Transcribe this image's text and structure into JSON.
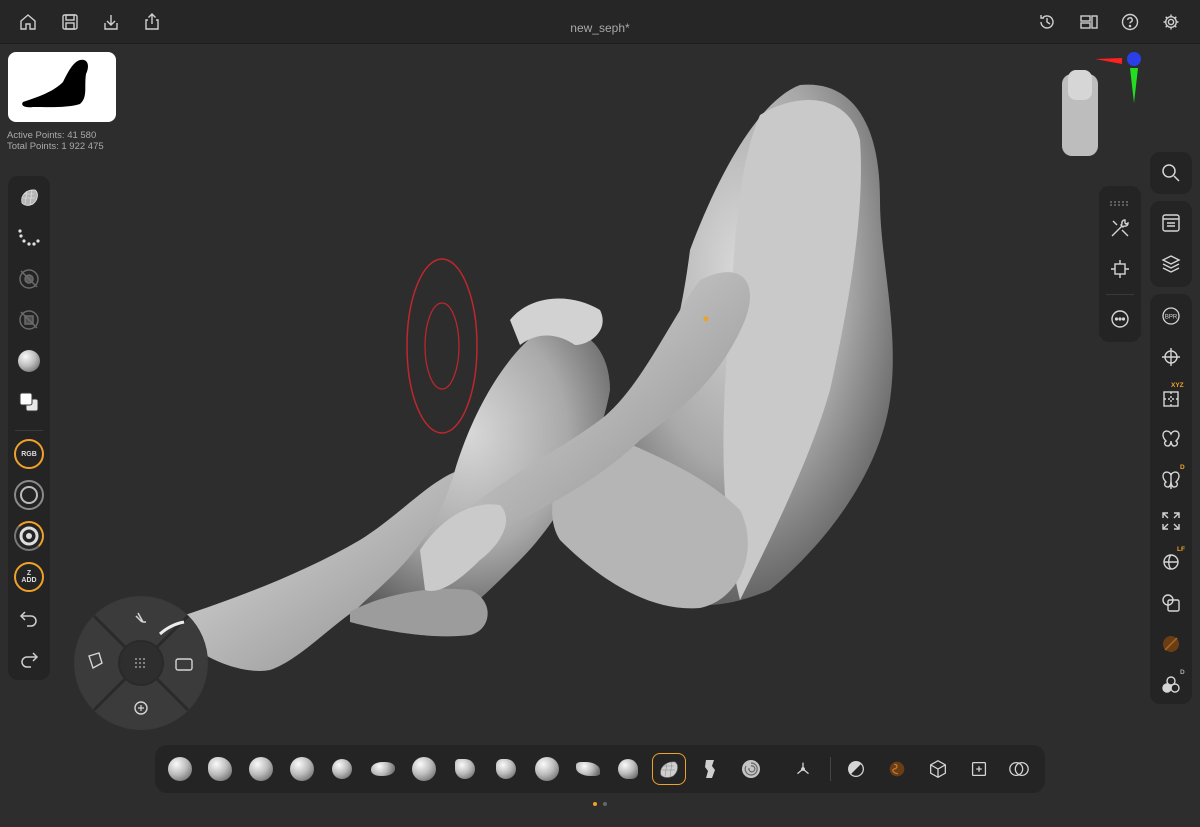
{
  "document": {
    "title": "new_seph*"
  },
  "stats": {
    "active_points": "Active Points: 41 580",
    "total_points": "Total Points: 1 922 475"
  },
  "top_toolbar": {
    "left_icons": [
      "home-icon",
      "save-icon",
      "import-icon",
      "share-icon"
    ],
    "right_icons": [
      "history-icon",
      "layout-icon",
      "help-icon",
      "settings-icon"
    ]
  },
  "left_toolbar": {
    "tools": [
      "mesh-icon",
      "stroke-icon",
      "alpha-off-icon",
      "texture-off-icon",
      "material-icon",
      "color-swatch-icon"
    ],
    "dials": {
      "rgb": {
        "top": "RGB",
        "sub": ""
      },
      "focal": {
        "top": ""
      },
      "intensity": {
        "top": ""
      },
      "zadd": {
        "top": "Z",
        "sub": "ADD"
      }
    },
    "history": [
      "undo-icon",
      "redo-icon"
    ]
  },
  "right_top_panel": {
    "tools": [
      "tools-icon",
      "gizmo-icon",
      "more-icon"
    ]
  },
  "right_toolbar": {
    "tools": [
      "search-icon",
      "palette-icon",
      "layers-icon",
      "bpr-icon",
      "transform-icon",
      "symmetry-xyz-icon",
      "symmetry-icon",
      "symmetry-d-icon",
      "frame-icon",
      "lightbox-icon",
      "duplicate-icon",
      "polyframe-icon",
      "solo-icon"
    ],
    "labels": {
      "xyz": "XYZ",
      "d1": "D",
      "lf": "LF",
      "d2": "D",
      "bpr": "BPR"
    }
  },
  "brush_bar": {
    "brushes": [
      "standard-brush",
      "clay-brush",
      "clay-buildup-brush",
      "dam-standard-brush",
      "inflate-brush",
      "move-brush",
      "snake-hook-brush",
      "trim-dynamic-brush",
      "h-polish-brush",
      "smooth-brush",
      "pinch-brush",
      "hpolish-brush",
      "mesh-brush",
      "knife-brush",
      "curve-brush"
    ],
    "active_index": 12,
    "extra": [
      "gizmo-3d-icon",
      "mask-icon",
      "polygroup-icon",
      "cube-icon",
      "crop-icon",
      "boolean-icon"
    ]
  },
  "pager": {
    "pages": 2,
    "current": 0
  },
  "colors": {
    "accent": "#f0a12a",
    "brush_ring": "#c0272d",
    "axis_x": "#ff2020",
    "axis_y": "#22dd22",
    "axis_z": "#2b3fe8"
  }
}
